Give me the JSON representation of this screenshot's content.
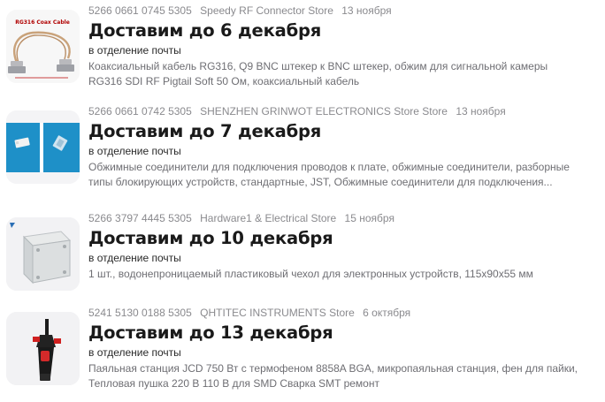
{
  "orders": [
    {
      "tracking": "5266 0661 0745 5305",
      "store": "Speedy RF Connector Store",
      "date": "13 ноября",
      "delivery": "Доставим до 6 декабря",
      "pickup": "в отделение почты",
      "title_line1": "Коаксиальный кабель RG316, Q9 BNC штекер к BNC штекер, обжим для сигнальной камеры",
      "title_line2": "RG316 SDI RF Pigtail Soft 50 Ом, коаксиальный кабель",
      "image_caption": "RG316 Coax Cable",
      "image_icon": "coax-cable-icon"
    },
    {
      "tracking": "5266 0661 0742 5305",
      "store": "SHENZHEN GRINWOT ELECTRONICS Store Store",
      "date": "13 ноября",
      "delivery": "Доставим до 7 декабря",
      "pickup": "в отделение почты",
      "title_line1": "Обжимные соединители для подключения проводов к плате, обжимные соединители, разборные",
      "title_line2": "типы блокирующих устройств, стандартные, JST, Обжимные соединители для подключения...",
      "image_icon": "crimp-connector-icon"
    },
    {
      "tracking": "5266 3797 4445 5305",
      "store": "Hardware1 & Electrical Store",
      "date": "15 ноября",
      "delivery": "Доставим до 10 декабря",
      "pickup": "в отделение почты",
      "title_line1": "1 шт., водонепроницаемый пластиковый чехол для электронных устройств, 115x90x55 мм",
      "title_line2": "",
      "image_icon": "plastic-enclosure-icon"
    },
    {
      "tracking": "5241 5130 0188 5305",
      "store": "QHTITEC INSTRUMENTS Store",
      "date": "6 октября",
      "delivery": "Доставим до 13 декабря",
      "pickup": "в отделение почты",
      "title_line1": "Паяльная станция JCD 750 Вт с термофеном 8858A BGA, микропаяльная станция, фен для пайки,",
      "title_line2": "Тепловая пушка 220 В 110 В для SMD Сварка SMT ремонт",
      "image_icon": "heat-gun-icon"
    }
  ]
}
